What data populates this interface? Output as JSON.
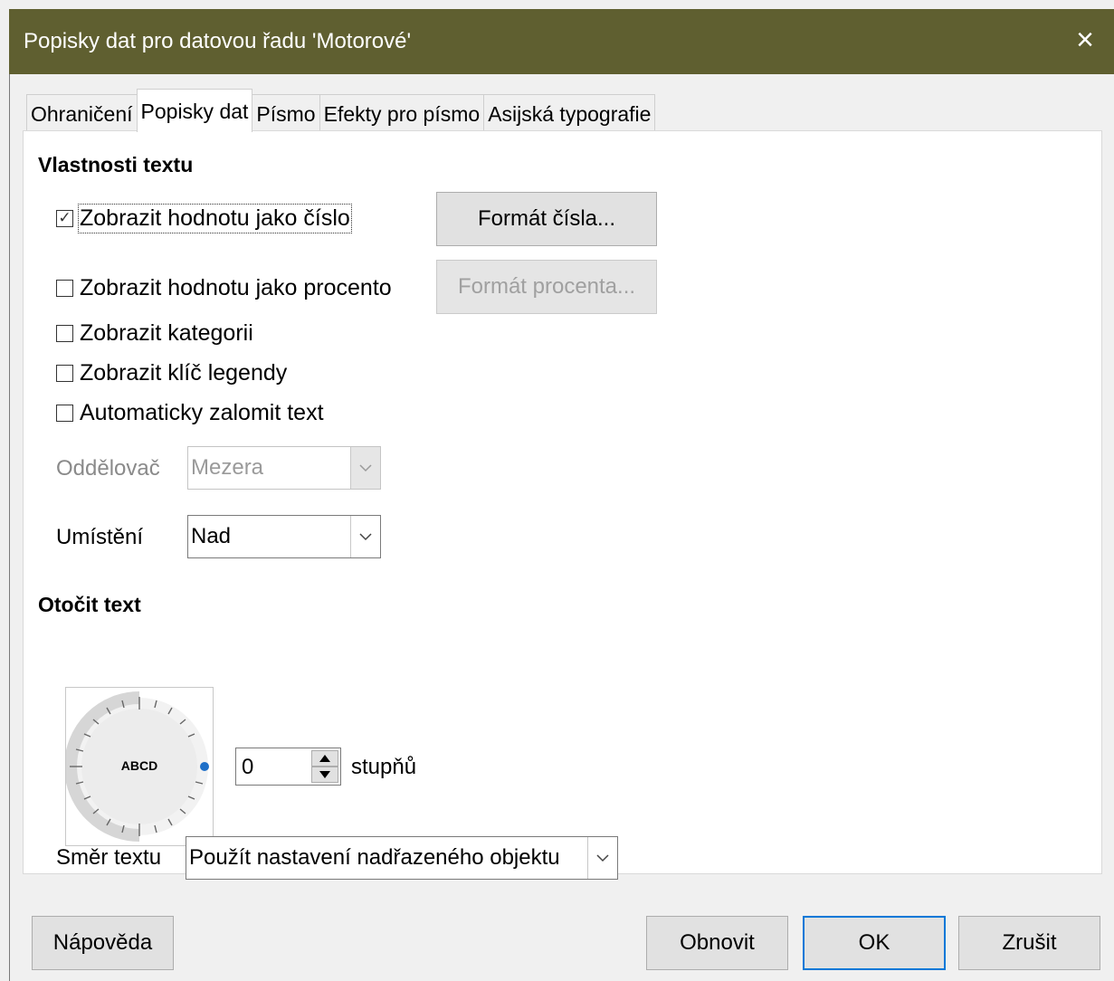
{
  "window": {
    "title": "Popisky dat pro datovou řadu 'Motorové'",
    "close_icon": "×"
  },
  "tabs": [
    {
      "label": "Ohraničení",
      "active": false
    },
    {
      "label": "Popisky dat",
      "active": true
    },
    {
      "label": "Písmo",
      "active": false
    },
    {
      "label": "Efekty pro písmo",
      "active": false
    },
    {
      "label": "Asijská typografie",
      "active": false
    }
  ],
  "text_properties": {
    "heading": "Vlastnosti textu",
    "show_value_number": {
      "label": "Zobrazit hodnotu jako číslo",
      "checked": true
    },
    "number_format_button": "Formát čísla...",
    "show_value_percent": {
      "label": "Zobrazit hodnotu jako procento",
      "checked": false
    },
    "percent_format_button": "Formát procenta...",
    "show_category": {
      "label": "Zobrazit kategorii",
      "checked": false
    },
    "show_legend_key": {
      "label": "Zobrazit klíč legendy",
      "checked": false
    },
    "auto_wrap": {
      "label": "Automaticky zalomit text",
      "checked": false
    },
    "separator": {
      "label": "Oddělovač",
      "value": "Mezera"
    },
    "placement": {
      "label": "Umístění",
      "value": "Nad"
    }
  },
  "rotate_text": {
    "heading": "Otočit text",
    "dial_sample": "ABCD",
    "degrees_value": "0",
    "degrees_unit": "stupňů",
    "text_direction": {
      "label": "Směr textu",
      "value": "Použít nastavení nadřazeného objektu"
    }
  },
  "buttons": {
    "help": "Nápověda",
    "reset": "Obnovit",
    "ok": "OK",
    "cancel": "Zrušit"
  },
  "colors": {
    "titlebar": "#5f5f30",
    "accent": "#0078d7",
    "dial_marker": "#1e6fc8"
  }
}
